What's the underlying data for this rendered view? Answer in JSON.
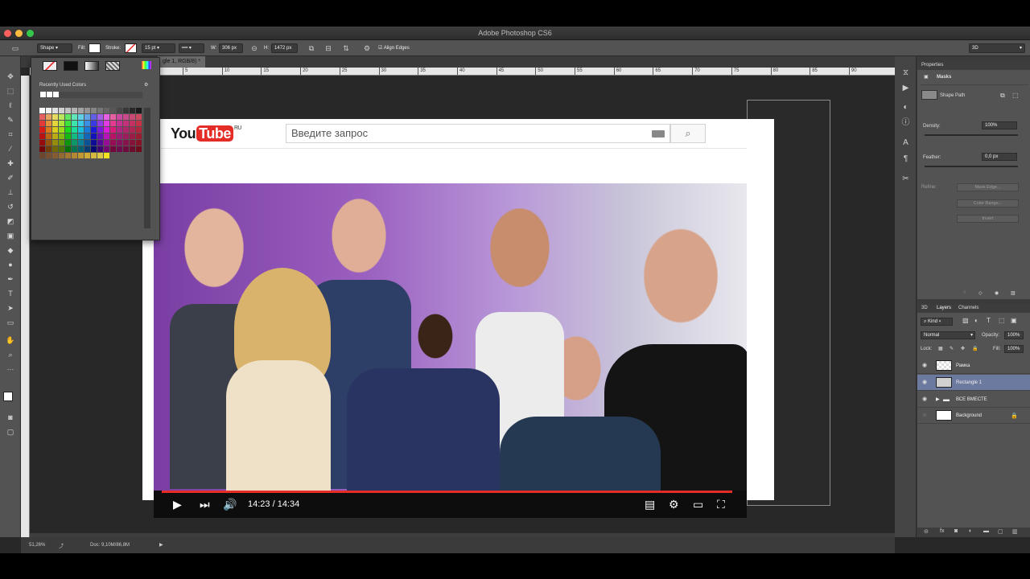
{
  "app": {
    "title": "Adobe Photoshop CS6"
  },
  "options_bar": {
    "mode": "Shape",
    "fill_label": "Fill:",
    "stroke_label": "Stroke:",
    "stroke_size": "15 pt",
    "w_label": "W:",
    "w_value": "306 px",
    "h_label": "H:",
    "h_value": "1472 px",
    "align_edges": "Align Edges",
    "workspace": "3D"
  },
  "document": {
    "tab_title": "gle 1, RGB/8) *",
    "zoom": "51,26%",
    "doc_info": "Doc: 9,10M/86,8M"
  },
  "ruler_ticks": [
    "5",
    "10",
    "15",
    "20",
    "25",
    "30",
    "35",
    "40",
    "45",
    "50",
    "55",
    "60",
    "65",
    "70",
    "75",
    "80",
    "85",
    "90"
  ],
  "swatch_panel": {
    "recent_label": "Recently Used Colors"
  },
  "youtube": {
    "logo_you": "You",
    "logo_tube": "Tube",
    "logo_region": "RU",
    "search_placeholder": "Введите запрос",
    "time": "14:23 / 14:34",
    "progress_fraction": 0.99
  },
  "properties": {
    "tab": "Properties",
    "section": "Masks",
    "shape_path": "Shape Path",
    "density_label": "Density:",
    "density_value": "100%",
    "feather_label": "Feather:",
    "feather_value": "0,0 px",
    "refine_label": "Refine:",
    "mask_edge": "Mask Edge...",
    "color_range": "Color Range...",
    "invert": "Invert"
  },
  "layers_panel": {
    "tabs": [
      "3D",
      "Layers",
      "Channels"
    ],
    "kind": "Kind",
    "blend_mode": "Normal",
    "opacity_label": "Opacity:",
    "opacity_value": "100%",
    "lock_label": "Lock:",
    "fill_label": "Fill:",
    "fill_value": "100%",
    "layers": [
      {
        "name": "Рамка",
        "selected": false
      },
      {
        "name": "Rectangle 1",
        "selected": true
      },
      {
        "name": "ВСЕ ВМЕСТЕ",
        "selected": false,
        "group": true
      },
      {
        "name": "Background",
        "selected": false,
        "locked": true
      }
    ]
  },
  "colors": {
    "youtube_red": "#e52d27",
    "layer_selected": "#6d7aa0",
    "panel_bg": "#535353"
  }
}
